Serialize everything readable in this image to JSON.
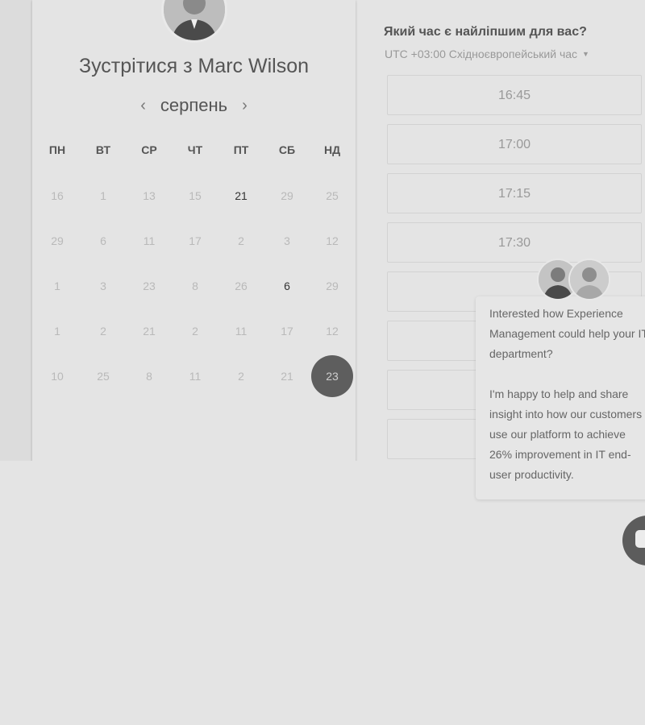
{
  "scheduler": {
    "title": "Зустрітися з Marc Wilson",
    "month": "серпень",
    "prev_icon": "chevron-left-icon",
    "next_icon": "chevron-right-icon",
    "weekdays": [
      "ПН",
      "ВТ",
      "СР",
      "ЧТ",
      "ПТ",
      "СБ",
      "НД"
    ],
    "weeks": [
      [
        "16",
        "1",
        "13",
        "15",
        "21",
        "29",
        "25"
      ],
      [
        "29",
        "6",
        "11",
        "17",
        "2",
        "3",
        "12"
      ],
      [
        "1",
        "3",
        "23",
        "8",
        "26",
        "6",
        "29"
      ],
      [
        "1",
        "2",
        "21",
        "2",
        "11",
        "17",
        "12"
      ],
      [
        "10",
        "25",
        "8",
        "11",
        "2",
        "21",
        "23"
      ]
    ],
    "active_days": [
      "21",
      "6"
    ],
    "selected_day": "23"
  },
  "times": {
    "question": "Який час є найліпшим для вас?",
    "timezone": "UTC +03:00 Східноєвропейський час",
    "slots": [
      "16:45",
      "17:00",
      "17:15",
      "17:30",
      "",
      "",
      "",
      ""
    ]
  },
  "chat": {
    "message_1": "Interested how Experience Management could help your IT department?",
    "message_2": "I'm happy to help and share insight into how our customers use our platform to achieve 26% improvement in IT end-user productivity.",
    "launcher_icon": "chat-bubble-icon"
  },
  "colors": {
    "background": "#e4e4e4",
    "selected_day": "#5e5e5e",
    "chat_button": "#5c5c5c"
  }
}
